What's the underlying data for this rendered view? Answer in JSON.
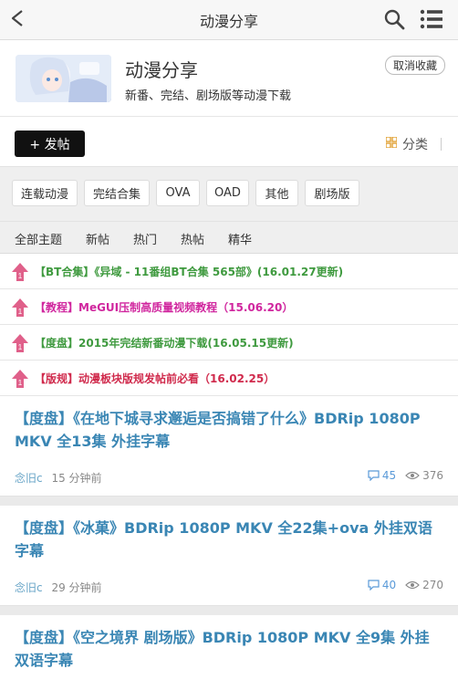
{
  "header": {
    "title": "动漫分享"
  },
  "forum": {
    "name": "动漫分享",
    "description": "新番、完结、剧场版等动漫下载",
    "unfav_label": "取消收藏"
  },
  "toolbar": {
    "post_label": "+ 发帖",
    "category_label": "分类"
  },
  "chips": [
    "连载动漫",
    "完结合集",
    "OVA",
    "OAD",
    "其他",
    "剧场版"
  ],
  "tabs": [
    "全部主题",
    "新帖",
    "热门",
    "热帖",
    "精华"
  ],
  "sticky": [
    {
      "text": "【BT合集】《异域 - 11番组BT合集 565部》(16.01.27更新)",
      "color": "#3f9a3f"
    },
    {
      "text": "【教程】MeGUI压制高质量视频教程（15.06.20）",
      "color": "#d0269e"
    },
    {
      "text": "【度盘】2015年完结新番动漫下载(16.05.15更新)",
      "color": "#3f9a3f"
    },
    {
      "text": "【版规】动漫板块版规发帖前必看（16.02.25）",
      "color": "#d02a4c"
    }
  ],
  "threads": [
    {
      "title": "【度盘】《在地下城寻求邂逅是否搞错了什么》BDRip 1080P MKV 全13集 外挂字幕",
      "author": "念旧c",
      "time": "15 分钟前",
      "replies": "45",
      "views": "376"
    },
    {
      "title": "【度盘】《冰菓》BDRip 1080P MKV 全22集+ova 外挂双语字幕",
      "author": "念旧c",
      "time": "29 分钟前",
      "replies": "40",
      "views": "270"
    },
    {
      "title": "【度盘】《空之境界 剧场版》BDRip 1080P MKV 全9集 外挂双语字幕",
      "author": "",
      "time": "",
      "replies": "",
      "views": ""
    }
  ]
}
